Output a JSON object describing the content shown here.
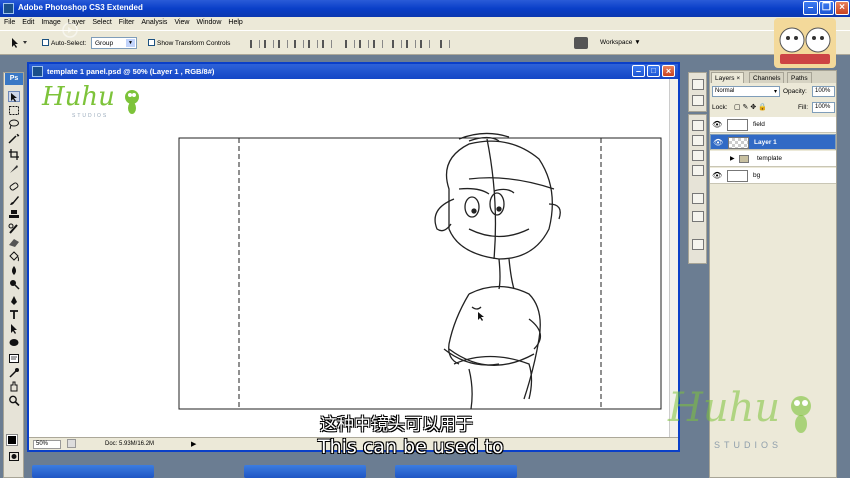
{
  "app": {
    "title": "Adobe Photoshop CS3 Extended"
  },
  "menu": [
    "File",
    "Edit",
    "Image",
    "Layer",
    "Select",
    "Filter",
    "Analysis",
    "View",
    "Window",
    "Help"
  ],
  "options": {
    "auto_select_label": "Auto-Select:",
    "auto_select_value": "Group",
    "show_transform_label": "Show Transform Controls",
    "workspace_label": "Workspace"
  },
  "toolbar": {
    "ps_label": "Ps"
  },
  "document": {
    "title": "template 1 panel.psd @ 50% (Layer 1 , RGB/8#)",
    "zoom": "50%",
    "doc_size": "Doc: 5.93M/16.2M"
  },
  "layers_panel": {
    "tabs": [
      "Layers",
      "Channels",
      "Paths"
    ],
    "blend_mode": "Normal",
    "opacity_label": "Opacity:",
    "opacity_value": "100%",
    "lock_label": "Lock:",
    "fill_label": "Fill:",
    "fill_value": "100%",
    "layers": [
      {
        "name": "field",
        "visible": true,
        "selected": false,
        "group": false
      },
      {
        "name": "Layer 1",
        "visible": true,
        "selected": true,
        "group": false
      },
      {
        "name": "template",
        "visible": false,
        "selected": false,
        "group": true
      },
      {
        "name": "bg",
        "visible": true,
        "selected": false,
        "group": false
      }
    ]
  },
  "watermark": {
    "logo": "Huhu",
    "sub": "STUDIOS"
  },
  "subtitles": {
    "cn": "这种中镜头可以用于",
    "en": "This can be used to"
  },
  "colors": {
    "title_blue": "#0a3fc8",
    "selected_layer": "#316ac5",
    "logo_green": "#7dc33a"
  }
}
